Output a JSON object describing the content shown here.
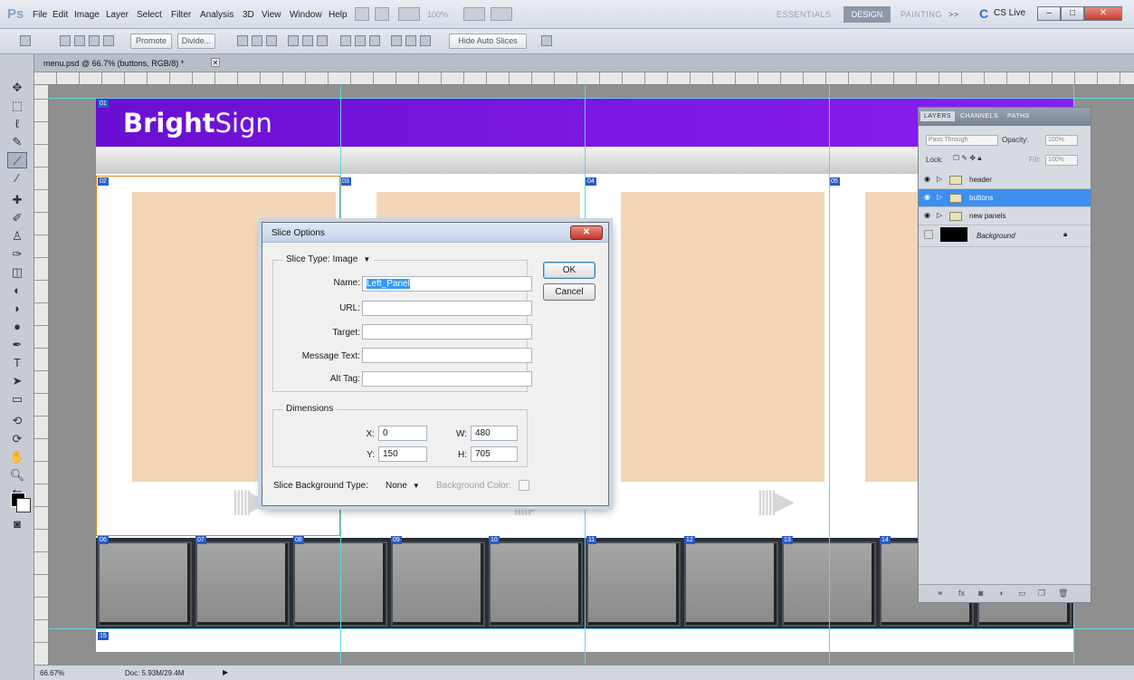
{
  "app": {
    "logo": "Ps"
  },
  "menu": [
    "File",
    "Edit",
    "Image",
    "Layer",
    "Select",
    "Filter",
    "Analysis",
    "3D",
    "View",
    "Window",
    "Help"
  ],
  "menubar": {
    "zoom": "100%"
  },
  "workspaces": {
    "essentials": "ESSENTIALS",
    "design": "DESIGN",
    "painting": "PAINTING",
    "more": ">>"
  },
  "cslive": "CS Live",
  "options": {
    "promote": "Promote",
    "divide": "Divide...",
    "hide_auto_slices": "Hide Auto Slices"
  },
  "document": {
    "tab": "menu.psd @ 66.7% (buttons, RGB/8) *",
    "brand_bold": "Bright",
    "brand_light": "Sign"
  },
  "slice_labels": [
    "01",
    "02",
    "03",
    "04",
    "05",
    "06",
    "07",
    "08",
    "09",
    "10",
    "11",
    "12",
    "13",
    "14",
    "15"
  ],
  "layers_panel": {
    "tabs": [
      "LAYERS",
      "CHANNELS",
      "PATHS"
    ],
    "blend_mode": "Pass Through",
    "opacity_label": "Opacity:",
    "opacity_value": "100%",
    "lock_label": "Lock:",
    "fill_label": "Fill:",
    "fill_value": "100%",
    "layers": [
      {
        "name": "header",
        "selected": false
      },
      {
        "name": "buttons",
        "selected": true
      },
      {
        "name": "new panels",
        "selected": false
      },
      {
        "name": "Background",
        "selected": false
      }
    ]
  },
  "status": {
    "zoom": "66.67%",
    "doc": "Doc: 5.93M/29.4M"
  },
  "dialog": {
    "title": "Slice Options",
    "slice_type_label": "Slice Type:",
    "slice_type_value": "Image",
    "name_label": "Name:",
    "name_value": "Left_Panel",
    "url_label": "URL:",
    "url_value": "",
    "target_label": "Target:",
    "target_value": "",
    "message_label": "Message Text:",
    "message_value": "",
    "alt_label": "Alt Tag:",
    "alt_value": "",
    "dimensions_label": "Dimensions",
    "x_label": "X:",
    "x_value": "0",
    "y_label": "Y:",
    "y_value": "150",
    "w_label": "W:",
    "w_value": "480",
    "h_label": "H:",
    "h_value": "705",
    "bg_type_label": "Slice Background Type:",
    "bg_type_value": "None",
    "bg_color_label": "Background Color:",
    "ok_label": "OK",
    "cancel_label": "Cancel"
  }
}
